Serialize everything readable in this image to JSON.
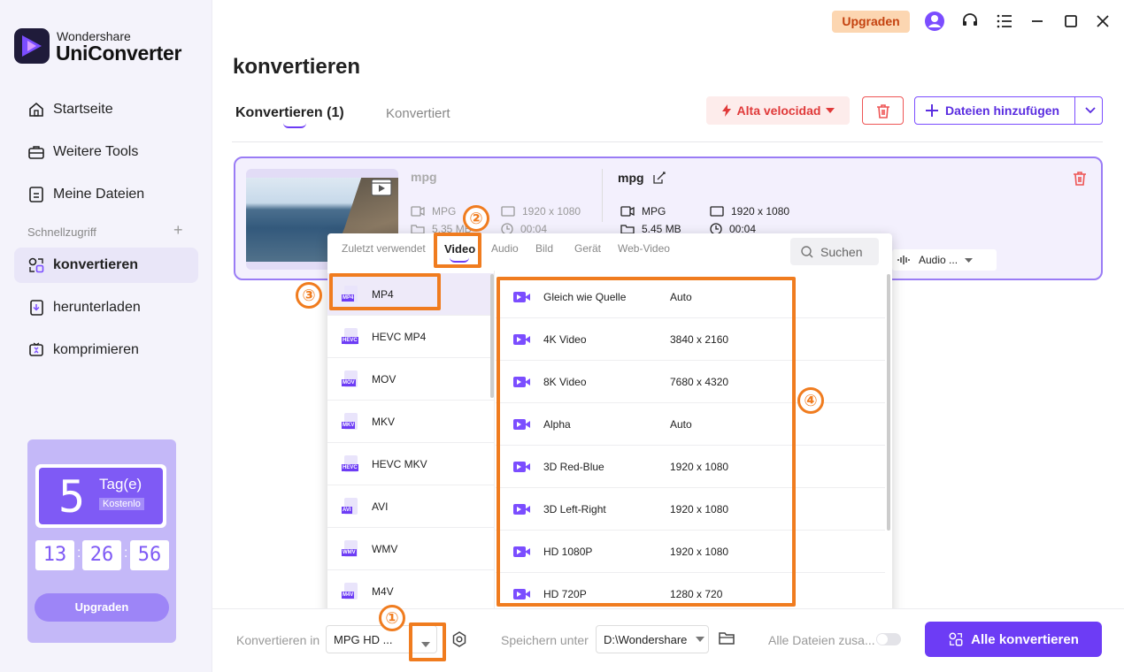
{
  "app": {
    "brand_line1": "Wondershare",
    "brand_line2": "UniConverter"
  },
  "sidebar": {
    "items": [
      {
        "label": "Startseite",
        "icon": "home-icon"
      },
      {
        "label": "Weitere Tools",
        "icon": "toolbox-icon"
      },
      {
        "label": "Meine Dateien",
        "icon": "files-icon"
      }
    ],
    "quick_access_label": "Schnellzugriff",
    "quick_items": [
      {
        "label": "konvertieren",
        "icon": "convert-icon",
        "active": true
      },
      {
        "label": "herunterladen",
        "icon": "download-icon"
      },
      {
        "label": "komprimieren",
        "icon": "compress-icon"
      }
    ],
    "promo": {
      "days": "5",
      "days_label": "Tag(e)",
      "free_label": "Kostenlo",
      "timer": [
        "13",
        "26",
        "56"
      ],
      "button": "Upgraden"
    }
  },
  "topbar": {
    "upgrade": "Upgraden"
  },
  "main": {
    "title": "konvertieren",
    "tabs": [
      {
        "label": "Konvertieren (1)"
      },
      {
        "label": "Konvertiert"
      }
    ],
    "speed_label": "Alta velocidad",
    "add_files_label": "Dateien hinzufügen"
  },
  "file": {
    "source_name": "mpg",
    "source_format": "MPG",
    "source_resolution": "1920 x 1080",
    "source_size": "5.35 MB",
    "source_duration": "00:04",
    "target_name": "mpg",
    "target_format": "MPG",
    "target_resolution": "1920 x 1080",
    "target_size": "5.45 MB",
    "target_duration": "00:04",
    "audio_label": "Audio ..."
  },
  "format_popup": {
    "tabs": [
      "Zuletzt verwendet",
      "Video",
      "Audio",
      "Bild",
      "Gerät",
      "Web-Video"
    ],
    "active_tab": "Video",
    "search_placeholder": "Suchen",
    "formats": [
      {
        "label": "MP4",
        "tag": "MP4"
      },
      {
        "label": "HEVC MP4",
        "tag": "HEVC"
      },
      {
        "label": "MOV",
        "tag": "MOV"
      },
      {
        "label": "MKV",
        "tag": "MKV"
      },
      {
        "label": "HEVC MKV",
        "tag": "HEVC"
      },
      {
        "label": "AVI",
        "tag": "AVI"
      },
      {
        "label": "WMV",
        "tag": "WMV"
      },
      {
        "label": "M4V",
        "tag": "M4V"
      }
    ],
    "resolutions": [
      {
        "name": "Gleich wie Quelle",
        "value": "Auto"
      },
      {
        "name": "4K Video",
        "value": "3840 x 2160"
      },
      {
        "name": "8K Video",
        "value": "7680 x 4320"
      },
      {
        "name": "Alpha",
        "value": "Auto"
      },
      {
        "name": "3D Red-Blue",
        "value": "1920 x 1080"
      },
      {
        "name": "3D Left-Right",
        "value": "1920 x 1080"
      },
      {
        "name": "HD 1080P",
        "value": "1920 x 1080"
      },
      {
        "name": "HD 720P",
        "value": "1280 x 720"
      }
    ]
  },
  "callouts": [
    "①",
    "②",
    "③",
    "④"
  ],
  "bottom": {
    "convert_in_label": "Konvertieren in",
    "convert_in_value": "MPG HD ...",
    "save_label": "Speichern unter",
    "save_value": "D:\\Wondershare",
    "merge_label": "Alle Dateien zusa...",
    "convert_all": "Alle konvertieren"
  },
  "colors": {
    "accent": "#6d3cf5",
    "highlight": "#f07c1f",
    "danger": "#e03a3a"
  }
}
